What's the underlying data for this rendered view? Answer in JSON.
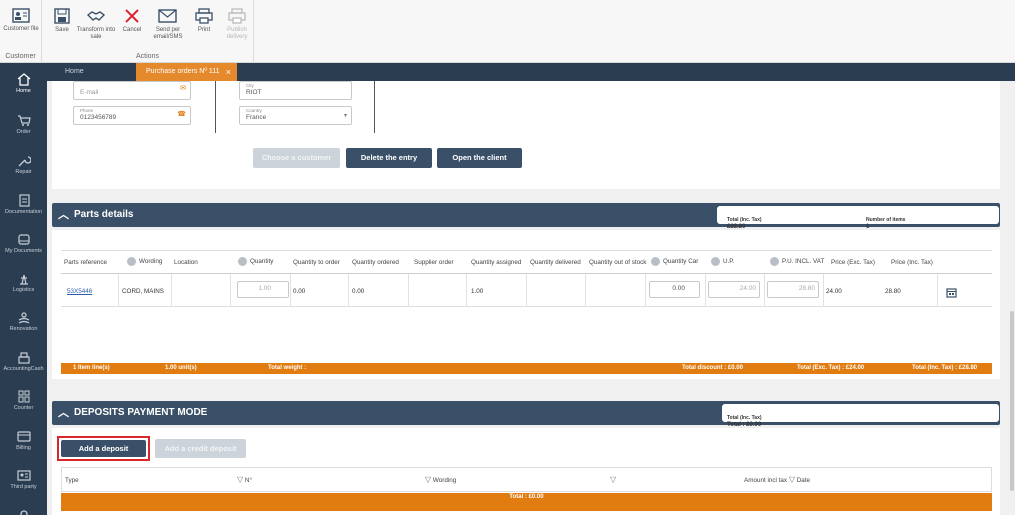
{
  "ribbon": {
    "customer_group": {
      "button_label": "Customer file",
      "caption": "Customer"
    },
    "actions_group": {
      "caption": "Actions",
      "buttons": [
        {
          "label": "Save",
          "icon": "save-icon",
          "enabled": true
        },
        {
          "label": "Transform into sale",
          "icon": "handshake-icon",
          "enabled": true
        },
        {
          "label": "Cancel",
          "icon": "close-icon",
          "enabled": true
        },
        {
          "label": "Send per email/SMS",
          "icon": "mail-icon",
          "enabled": true
        },
        {
          "label": "Print",
          "icon": "printer-icon",
          "enabled": true
        },
        {
          "label": "Publish delivery",
          "icon": "printer-icon",
          "enabled": false
        }
      ]
    }
  },
  "tabs": [
    {
      "label": "Home",
      "active": false
    },
    {
      "label": "Purchase orders Nº 111",
      "active": true
    }
  ],
  "sidebar": [
    {
      "label": "Home",
      "icon": "home-icon"
    },
    {
      "label": "Order",
      "icon": "cart-icon"
    },
    {
      "label": "Repair",
      "icon": "wrench-icon"
    },
    {
      "label": "Documentation",
      "icon": "document-icon"
    },
    {
      "label": "My Documents",
      "icon": "inbox-icon"
    },
    {
      "label": "Logistics",
      "icon": "logistics-icon"
    },
    {
      "label": "Renovation",
      "icon": "renovation-icon"
    },
    {
      "label": "AccountingCash",
      "icon": "cash-register-icon"
    },
    {
      "label": "Counter",
      "icon": "counter-icon"
    },
    {
      "label": "Billing",
      "icon": "card-icon"
    },
    {
      "label": "Third party",
      "icon": "id-card-icon"
    }
  ],
  "customer": {
    "email_placeholder": "E-mail",
    "phone_label": "Phone",
    "phone_value": "0123456789",
    "city_label": "City",
    "city_value": "RIOT",
    "country_label": "Country",
    "country_value": "France",
    "buttons": {
      "choose_customer": "Choose a customer",
      "delete_entry": "Delete the entry",
      "open_client": "Open the client"
    }
  },
  "parts": {
    "title": "Parts details",
    "summary": {
      "total_label": "Total (Inc. Tax)",
      "total_value": "£28.80",
      "items_label": "Number of items",
      "items_value": "1"
    },
    "columns": [
      "Parts reference",
      "Wording",
      "Location",
      "Quantity",
      "Quantity to order",
      "Quantity ordered",
      "Supplier order",
      "Quantity assigned",
      "Quantity delivered",
      "Quantity out of stock",
      "Quantity Car",
      "U.P.",
      "P.U. INCL. VAT",
      "Price (Exc. Tax)",
      "Price (Inc. Tax)"
    ],
    "row": {
      "reference": "53X5446",
      "wording": "CORD, MAINS",
      "quantity": "1.00",
      "qty_to_order": "0.00",
      "qty_ordered": "0.00",
      "qty_assigned": "1.00",
      "qty_car": "0.00",
      "up": "24.00",
      "pu_incl_vat": "28.80",
      "price_exc": "24.00",
      "price_inc": "28.80"
    },
    "footer": {
      "item_lines": "1 Item line(s)",
      "units": "1.00 unit(s)",
      "weight": "Total weight :",
      "discount": "Total discount : £0.00",
      "total_exc": "Total (Exc. Tax) : £24.00",
      "total_inc": "Total (Inc. Tax) : £28.80"
    }
  },
  "deposits": {
    "title": "DEPOSITS PAYMENT MODE",
    "summary": {
      "total_label": "Total (Inc. Tax)",
      "total_value": "Total : £0.00"
    },
    "add_deposit": "Add a deposit",
    "add_credit_deposit": "Add a credit deposit",
    "columns": [
      "Type",
      "N°",
      "Wording",
      "Amount incl tax",
      "Date"
    ],
    "footer_total": "Total : £0.00"
  },
  "colors": {
    "accent": "#e07c10",
    "header": "#3a5068",
    "sidebar": "#2b3d51",
    "highlight": "#d9262c"
  }
}
